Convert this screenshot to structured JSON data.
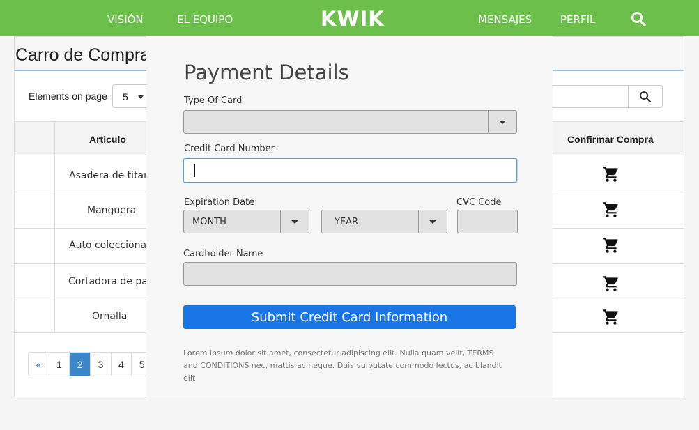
{
  "nav": {
    "items_left": [
      "VISIÓN",
      "EL EQUIPO"
    ],
    "brand": "KWIK",
    "items_right": [
      "MENSAJES",
      "PERFIL"
    ],
    "search_icon": "search-icon"
  },
  "page": {
    "title": "Carro de Compras",
    "elements_label": "Elements on page",
    "elements_value": "5",
    "search_placeholder": ""
  },
  "table": {
    "headers": [
      "Articulo",
      "Confirmar Compra"
    ],
    "rows": [
      {
        "name": "Asadera de titanic",
        "icon": "cart-icon"
      },
      {
        "name": "Manguera",
        "icon": "cart-icon"
      },
      {
        "name": "Auto coleccionable",
        "icon": "cart-icon"
      },
      {
        "name": "Cortadora de paste",
        "icon": "cart-icon"
      },
      {
        "name": "Ornalla",
        "icon": "cart-icon"
      }
    ]
  },
  "pagination": {
    "prev": "«",
    "pages": [
      "1",
      "2",
      "3",
      "4",
      "5"
    ],
    "active": "2"
  },
  "modal": {
    "title": "Payment Details",
    "type_label": "Type Of Card",
    "type_value": "",
    "cc_label": "Credit Card Number",
    "exp_label": "Expiration Date",
    "month_value": "MONTH",
    "year_value": "YEAR",
    "cvc_label": "CVC Code",
    "holder_label": "Cardholder Name",
    "submit_label": "Submit Credit Card Information",
    "footer_text": "Lorem ipsum dolor sit amet, consectetur adipiscing elit. Nulla quam velit, TERMS and CONDITIONS nec, mattis ac neque. Duis vulputate commodo lectus, ac blandit elit"
  }
}
